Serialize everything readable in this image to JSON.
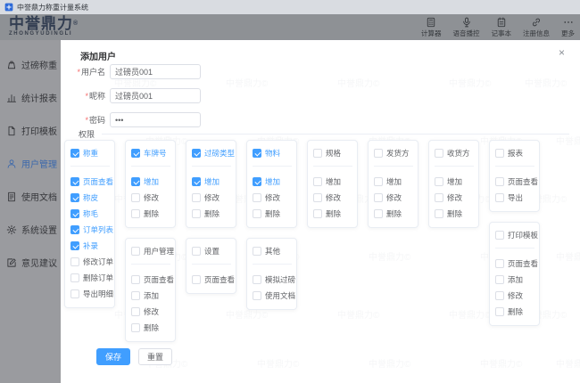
{
  "window": {
    "title": "中誉鼎力称重计量系统"
  },
  "header": {
    "logo_text": "中誉鼎力",
    "logo_reg": "®",
    "logo_sub": "ZHONGYUDINGLI",
    "actions": [
      {
        "key": "calculator",
        "label": "计算器",
        "icon": "calculator-icon"
      },
      {
        "key": "voice",
        "label": "语音播控",
        "icon": "microphone-icon"
      },
      {
        "key": "notepad",
        "label": "记事本",
        "icon": "notepad-icon"
      },
      {
        "key": "register",
        "label": "注册信息",
        "icon": "link-icon"
      },
      {
        "key": "more",
        "label": "更多",
        "icon": "more-icon"
      }
    ]
  },
  "sidebar": {
    "items": [
      {
        "key": "weighing",
        "label": "过磅称重",
        "icon": "scale-icon",
        "active": false
      },
      {
        "key": "reports",
        "label": "统计报表",
        "icon": "bar-chart-icon",
        "active": false
      },
      {
        "key": "print-template",
        "label": "打印模板",
        "icon": "print-template-icon",
        "active": false
      },
      {
        "key": "user-management",
        "label": "用户管理",
        "icon": "user-icon",
        "active": true
      },
      {
        "key": "usage-docs",
        "label": "使用文档",
        "icon": "document-icon",
        "active": false
      },
      {
        "key": "system-settings",
        "label": "系统设置",
        "icon": "gear-icon",
        "active": false
      },
      {
        "key": "feedback",
        "label": "意见建议",
        "icon": "feedback-icon",
        "active": false
      }
    ]
  },
  "modal": {
    "title": "添加用户",
    "close_label": "×",
    "fields": [
      {
        "key": "username",
        "label": "用户名",
        "required": true,
        "value": "过磅员001"
      },
      {
        "key": "nickname",
        "label": "昵称",
        "required": true,
        "value": "过磅员001"
      },
      {
        "key": "password",
        "label": "密码",
        "required": true,
        "value": "•••"
      }
    ],
    "permissions_label": "权限",
    "permission_columns": [
      [
        {
          "title": "称重",
          "checked": true,
          "items": [
            {
              "label": "页面查看",
              "checked": true
            },
            {
              "label": "称皮",
              "checked": true
            },
            {
              "label": "称毛",
              "checked": true
            },
            {
              "label": "订单列表",
              "checked": true
            },
            {
              "label": "补录",
              "checked": true
            },
            {
              "label": "修改订单",
              "checked": false
            },
            {
              "label": "删除订单",
              "checked": false
            },
            {
              "label": "导出明细",
              "checked": false
            }
          ]
        }
      ],
      [
        {
          "title": "车牌号",
          "checked": true,
          "items": [
            {
              "label": "增加",
              "checked": true
            },
            {
              "label": "修改",
              "checked": false
            },
            {
              "label": "删除",
              "checked": false
            }
          ]
        },
        {
          "title": "用户管理",
          "checked": false,
          "items": [
            {
              "label": "页面查看",
              "checked": false
            },
            {
              "label": "添加",
              "checked": false
            },
            {
              "label": "修改",
              "checked": false
            },
            {
              "label": "删除",
              "checked": false
            }
          ]
        }
      ],
      [
        {
          "title": "过磅类型",
          "checked": true,
          "items": [
            {
              "label": "增加",
              "checked": true
            },
            {
              "label": "修改",
              "checked": false
            },
            {
              "label": "删除",
              "checked": false
            }
          ]
        },
        {
          "title": "设置",
          "checked": false,
          "items": [
            {
              "label": "页面查看",
              "checked": false
            }
          ]
        }
      ],
      [
        {
          "title": "物料",
          "checked": true,
          "items": [
            {
              "label": "增加",
              "checked": true
            },
            {
              "label": "修改",
              "checked": false
            },
            {
              "label": "删除",
              "checked": false
            }
          ]
        },
        {
          "title": "其他",
          "checked": false,
          "items": [
            {
              "label": "模拟过磅",
              "checked": false
            },
            {
              "label": "使用文档",
              "checked": false
            }
          ]
        }
      ],
      [
        {
          "title": "规格",
          "checked": false,
          "items": [
            {
              "label": "增加",
              "checked": false
            },
            {
              "label": "修改",
              "checked": false
            },
            {
              "label": "删除",
              "checked": false
            }
          ]
        }
      ],
      [
        {
          "title": "发货方",
          "checked": false,
          "items": [
            {
              "label": "增加",
              "checked": false
            },
            {
              "label": "修改",
              "checked": false
            },
            {
              "label": "删除",
              "checked": false
            }
          ]
        }
      ],
      [
        {
          "title": "收货方",
          "checked": false,
          "items": [
            {
              "label": "增加",
              "checked": false
            },
            {
              "label": "修改",
              "checked": false
            },
            {
              "label": "删除",
              "checked": false
            }
          ]
        }
      ],
      [
        {
          "title": "报表",
          "checked": false,
          "items": [
            {
              "label": "页面查看",
              "checked": false
            },
            {
              "label": "导出",
              "checked": false
            }
          ]
        },
        {
          "title": "打印模板",
          "checked": false,
          "items": [
            {
              "label": "页面查看",
              "checked": false
            },
            {
              "label": "添加",
              "checked": false
            },
            {
              "label": "修改",
              "checked": false
            },
            {
              "label": "删除",
              "checked": false
            }
          ]
        }
      ]
    ],
    "buttons": {
      "save": "保存",
      "reset": "重置"
    }
  },
  "watermark": "中誉鼎力©",
  "colors": {
    "accent": "#409eff",
    "titlebar_bg": "#d9dce1",
    "header_bg": "#8e9195",
    "sidebar_bg": "#9a9b9f",
    "sidebar_active": "#3b68ac",
    "label_gray": "#606266",
    "required_red": "#f56c6c"
  }
}
